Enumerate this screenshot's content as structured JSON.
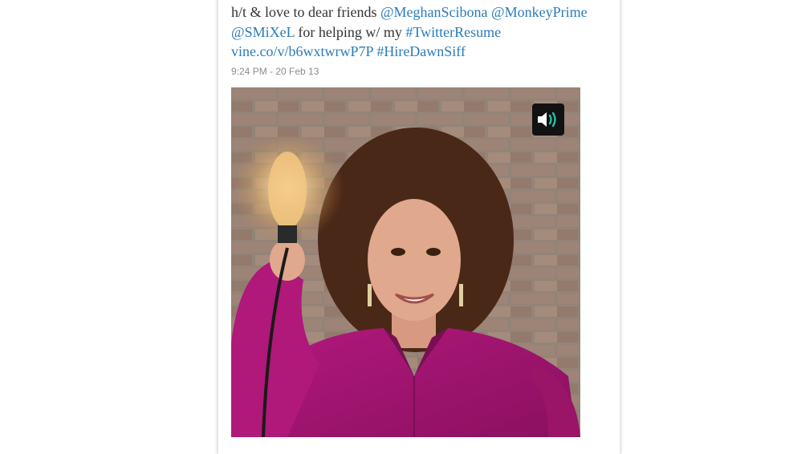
{
  "tweet": {
    "line1_prefix": "h/t & love to dear friends ",
    "mention1": "@MeghanScibona",
    "mention2": "@MonkeyPrime",
    "mention3": "@SMiXeL",
    "line2_text": " for helping w/ my ",
    "hashtag1": "#TwitterResume",
    "link": "vine.co/v/b6wxtwrwP7P",
    "hashtag2": "#HireDawnSiff",
    "timestamp": "9:24 PM - 20 Feb 13"
  },
  "media": {
    "type": "video",
    "sound_icon": "speaker-icon",
    "accent_color": "#1fc2a0"
  },
  "colors": {
    "link": "#2b7bb9",
    "text": "#333333",
    "meta": "#8c8c8c"
  }
}
